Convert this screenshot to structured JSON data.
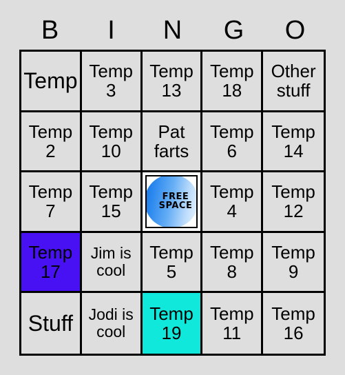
{
  "card": {
    "title": "BINGO",
    "headers": [
      "B",
      "I",
      "N",
      "G",
      "O"
    ],
    "colors": {
      "background": "#dedede",
      "cell_background": "#dedede",
      "grid_line": "#000000",
      "marked_purple": "#4711f4",
      "marked_cyan": "#11e8dc",
      "free_space_background": "#ffffff",
      "free_space_circle_dark": "#1173e0",
      "free_space_circle_light": "#f2f8fe",
      "text": "#000000"
    },
    "free_space": {
      "line1": "FREE",
      "line2": "SPACE"
    },
    "rows": [
      [
        {
          "text": "Temp",
          "size": "big",
          "state": "unmarked"
        },
        {
          "text": "Temp\n3",
          "size": "normal",
          "state": "unmarked"
        },
        {
          "text": "Temp\n13",
          "size": "normal",
          "state": "unmarked"
        },
        {
          "text": "Temp\n18",
          "size": "normal",
          "state": "unmarked"
        },
        {
          "text": "Other\nstuff",
          "size": "normal",
          "state": "unmarked"
        }
      ],
      [
        {
          "text": "Temp\n2",
          "size": "normal",
          "state": "unmarked"
        },
        {
          "text": "Temp\n10",
          "size": "normal",
          "state": "unmarked"
        },
        {
          "text": "Pat\nfarts",
          "size": "normal",
          "state": "unmarked"
        },
        {
          "text": "Temp\n6",
          "size": "normal",
          "state": "unmarked"
        },
        {
          "text": "Temp\n14",
          "size": "normal",
          "state": "unmarked"
        }
      ],
      [
        {
          "text": "Temp\n7",
          "size": "normal",
          "state": "unmarked"
        },
        {
          "text": "Temp\n15",
          "size": "normal",
          "state": "unmarked"
        },
        {
          "text": "",
          "size": "normal",
          "state": "free"
        },
        {
          "text": "Temp\n4",
          "size": "normal",
          "state": "unmarked"
        },
        {
          "text": "Temp\n12",
          "size": "normal",
          "state": "unmarked"
        }
      ],
      [
        {
          "text": "Temp\n17",
          "size": "normal",
          "state": "marked-purple"
        },
        {
          "text": "Jim is\ncool",
          "size": "small",
          "state": "unmarked"
        },
        {
          "text": "Temp\n5",
          "size": "normal",
          "state": "unmarked"
        },
        {
          "text": "Temp\n8",
          "size": "normal",
          "state": "unmarked"
        },
        {
          "text": "Temp\n9",
          "size": "normal",
          "state": "unmarked"
        }
      ],
      [
        {
          "text": "Stuff",
          "size": "big",
          "state": "unmarked"
        },
        {
          "text": "Jodi is\ncool",
          "size": "small",
          "state": "unmarked"
        },
        {
          "text": "Temp\n19",
          "size": "normal",
          "state": "marked-cyan"
        },
        {
          "text": "Temp\n11",
          "size": "normal",
          "state": "unmarked"
        },
        {
          "text": "Temp\n16",
          "size": "normal",
          "state": "unmarked"
        }
      ]
    ]
  }
}
